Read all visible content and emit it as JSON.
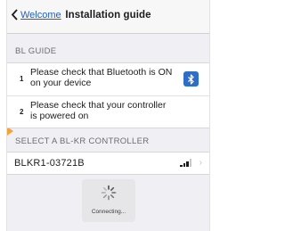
{
  "navbar": {
    "back_label": "Welcome",
    "title": "Installation guide"
  },
  "guide_section": {
    "header": "BL GUIDE",
    "steps": [
      {
        "number": "1",
        "text": "Please check that Bluetooth is ON on your device",
        "icon": "bluetooth-icon"
      },
      {
        "number": "2",
        "text": "Please check that your controller is powered on"
      }
    ]
  },
  "controller_section": {
    "header": "SELECT A BL-KR CONTROLLER",
    "items": [
      {
        "name": "BLKR1-03721B",
        "signal_bars_filled": 3,
        "signal_bars_total": 4
      }
    ]
  },
  "hud": {
    "status": "Connecting..."
  },
  "colors": {
    "accent": "#1f5fbf",
    "bluetooth_badge": "#2f6ec7",
    "background": "#efeff4"
  }
}
